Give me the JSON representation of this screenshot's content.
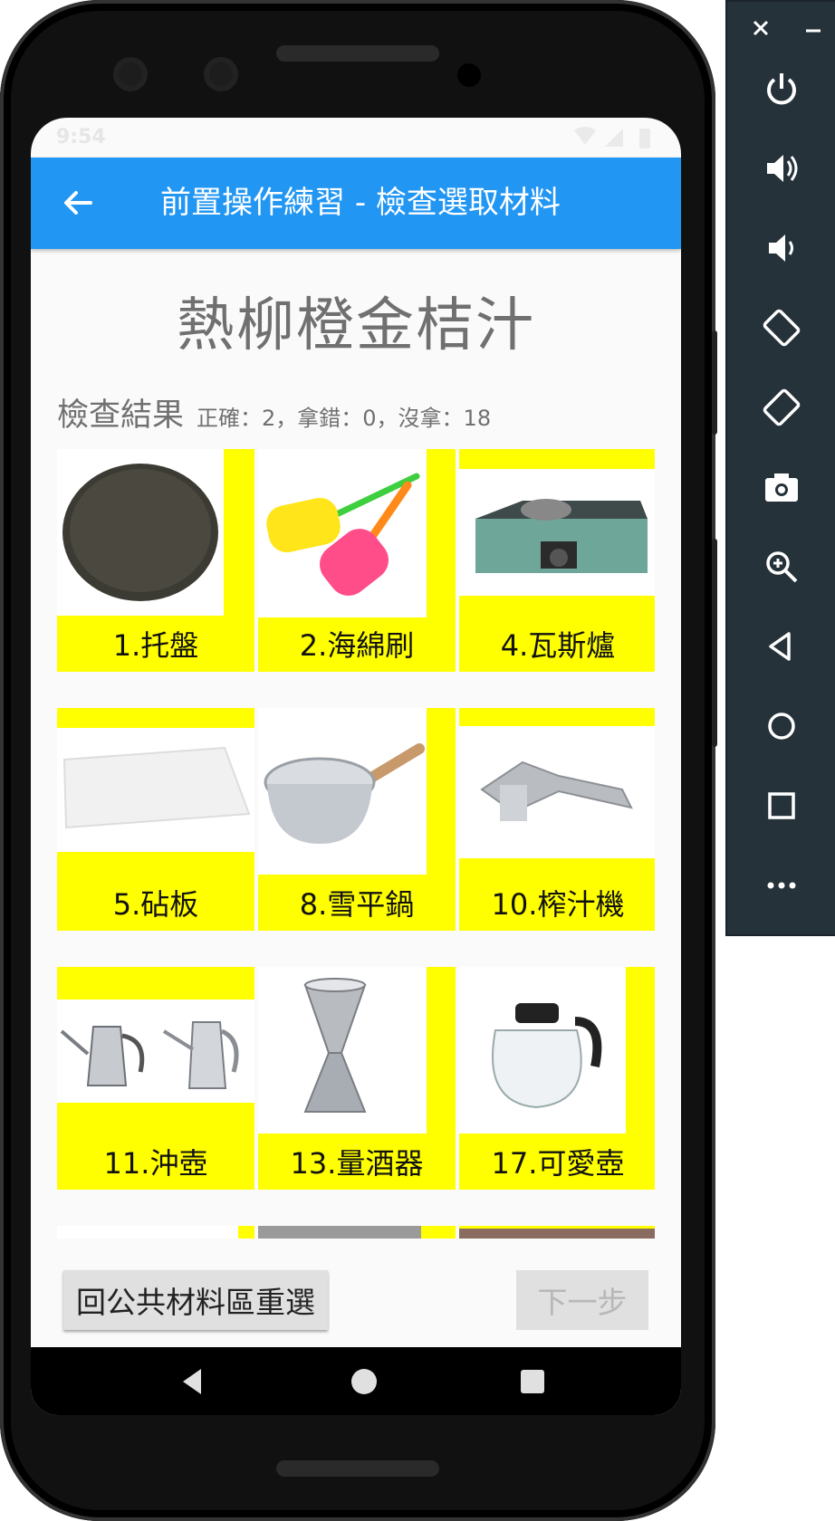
{
  "status_bar": {
    "time": "9:54"
  },
  "app_bar": {
    "title": "前置操作練習 - 檢查選取材料"
  },
  "dish_name": "熱柳橙金桔汁",
  "result": {
    "label": "檢查結果",
    "detail": "正確：2，拿錯：0，沒拿：18"
  },
  "items": [
    {
      "label": "1.托盤"
    },
    {
      "label": "2.海綿刷"
    },
    {
      "label": "4.瓦斯爐"
    },
    {
      "label": "5.砧板"
    },
    {
      "label": "8.雪平鍋"
    },
    {
      "label": "10.榨汁機"
    },
    {
      "label": "11.沖壺"
    },
    {
      "label": "13.量酒器"
    },
    {
      "label": "17.可愛壺"
    }
  ],
  "buttons": {
    "reselect": "回公共材料區重選",
    "next": "下一步"
  },
  "colors": {
    "app_bar": "#2196f3",
    "card_highlight": "#ffff00",
    "emulator_panel": "#25323a"
  },
  "emulator_controls": [
    "close-icon",
    "minimize-icon",
    "power-icon",
    "volume-up-icon",
    "volume-down-icon",
    "rotate-left-icon",
    "rotate-right-icon",
    "camera-icon",
    "zoom-icon",
    "back-icon",
    "home-icon",
    "overview-icon",
    "more-icon"
  ]
}
